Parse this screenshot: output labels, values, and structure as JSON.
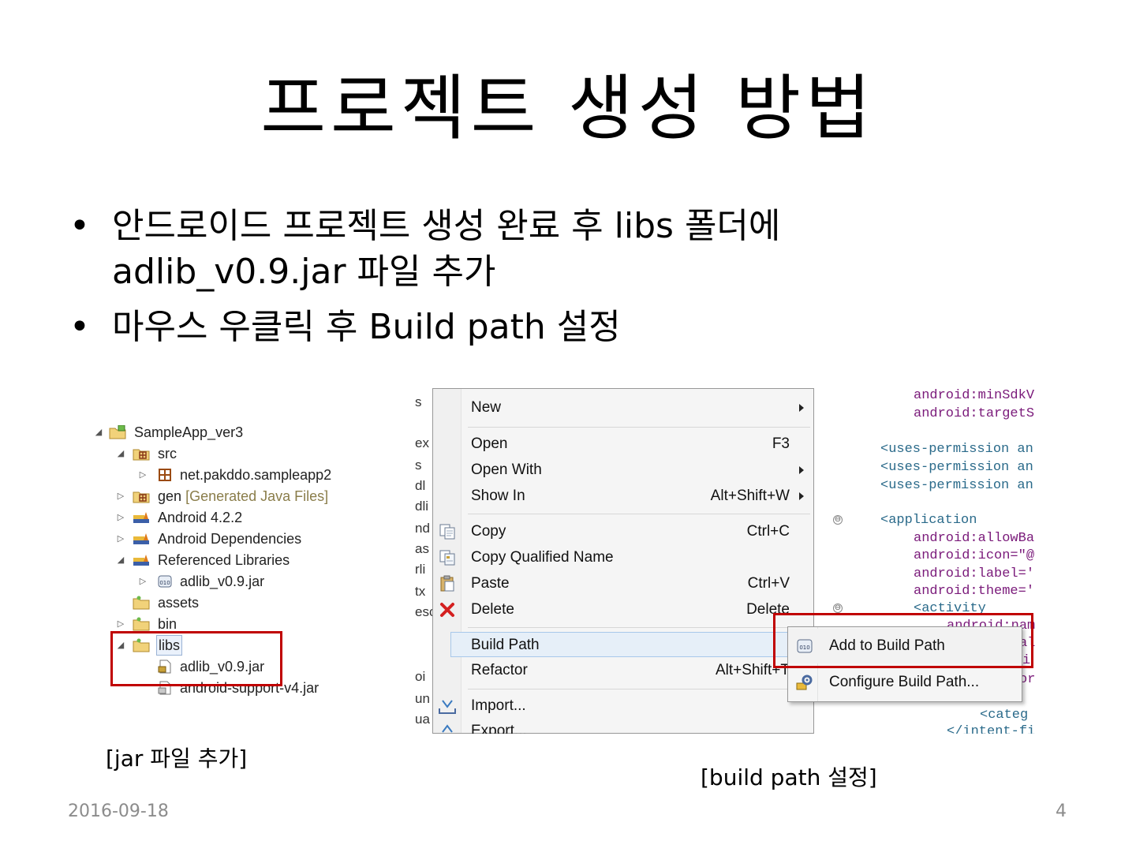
{
  "slide": {
    "title": "프로젝트 생성 방법",
    "bullets": [
      {
        "line1": "안드로이드 프로젝트 생성 완료 후 libs 폴더에",
        "line2": "adlib_v0.9.jar 파일 추가"
      },
      {
        "line1": "마우스 우클릭 후 Build path 설정"
      }
    ],
    "bullet_char": "•",
    "captions": {
      "left": "[jar 파일 추가]",
      "right": "[build path 설정]"
    },
    "footer": {
      "date": "2016-09-18",
      "page": "4"
    }
  },
  "explorer": {
    "items": [
      {
        "label": "SampleApp_ver3",
        "icon": "project-icon",
        "twisty": "◢"
      },
      {
        "label": "src",
        "icon": "source-folder-icon",
        "twisty": "◢"
      },
      {
        "label": "net.pakddo.sampleapp2",
        "icon": "package-icon",
        "twisty": "▷"
      },
      {
        "label": "gen",
        "dim": "[Generated Java Files]",
        "icon": "source-folder-icon",
        "twisty": "▷"
      },
      {
        "label": "Android 4.2.2",
        "icon": "library-icon",
        "twisty": "▷"
      },
      {
        "label": "Android Dependencies",
        "icon": "library-icon",
        "twisty": "▷"
      },
      {
        "label": "Referenced Libraries",
        "icon": "library-icon",
        "twisty": "◢"
      },
      {
        "label": "adlib_v0.9.jar",
        "icon": "jar-icon",
        "twisty": "▷"
      },
      {
        "label": "assets",
        "icon": "folder-icon",
        "twisty": ""
      },
      {
        "label": "bin",
        "icon": "folder-icon",
        "twisty": "▷"
      },
      {
        "label": "libs",
        "icon": "folder-icon",
        "twisty": "◢"
      },
      {
        "label": "adlib_v0.9.jar",
        "icon": "jar-file-icon",
        "twisty": ""
      },
      {
        "label": "android-support-v4.jar",
        "icon": "jar-file-icon",
        "twisty": ""
      }
    ]
  },
  "context_menu": {
    "bg_fragments": [
      "s",
      "ex",
      "s",
      "dl",
      "dli",
      "nd",
      "as",
      "rli",
      "tx",
      "esc",
      "oi",
      "un",
      "ua"
    ],
    "items": [
      {
        "label": "New",
        "shortcut": "",
        "submenu": true,
        "icon": ""
      },
      {
        "label": "Open",
        "shortcut": "F3",
        "submenu": false,
        "icon": ""
      },
      {
        "label": "Open With",
        "shortcut": "",
        "submenu": true,
        "icon": ""
      },
      {
        "label": "Show In",
        "shortcut": "Alt+Shift+W",
        "submenu": true,
        "icon": ""
      },
      {
        "label": "Copy",
        "shortcut": "Ctrl+C",
        "submenu": false,
        "icon": "copy-icon"
      },
      {
        "label": "Copy Qualified Name",
        "shortcut": "",
        "submenu": false,
        "icon": "copy-qualified-icon"
      },
      {
        "label": "Paste",
        "shortcut": "Ctrl+V",
        "submenu": false,
        "icon": "paste-icon"
      },
      {
        "label": "Delete",
        "shortcut": "Delete",
        "submenu": false,
        "icon": "delete-icon"
      },
      {
        "label": "Build Path",
        "shortcut": "",
        "submenu": true,
        "icon": ""
      },
      {
        "label": "Refactor",
        "shortcut": "Alt+Shift+T",
        "submenu": true,
        "icon": ""
      },
      {
        "label": "Import...",
        "shortcut": "",
        "submenu": false,
        "icon": "import-icon"
      },
      {
        "label": "Export...",
        "shortcut": "",
        "submenu": false,
        "icon": "export-icon"
      }
    ],
    "submenu": [
      {
        "label": "Add to Build Path",
        "icon": "jar-icon"
      },
      {
        "label": "Configure Build Path...",
        "icon": "configure-icon"
      }
    ]
  },
  "code_editor": {
    "lines": [
      {
        "text": "android:minSdkV",
        "kind": "attr"
      },
      {
        "text": "android:targetS",
        "kind": "attr"
      },
      {
        "text": "<uses-permission an",
        "kind": "tag"
      },
      {
        "text": "<uses-permission an",
        "kind": "tag"
      },
      {
        "text": "<uses-permission an",
        "kind": "tag"
      },
      {
        "text": "<application",
        "kind": "tag"
      },
      {
        "text": "android:allowBa",
        "kind": "attr"
      },
      {
        "text": "android:icon=\"@",
        "kind": "attr"
      },
      {
        "text": "android:label='",
        "kind": "attr"
      },
      {
        "text": "android:theme='",
        "kind": "attr"
      },
      {
        "text": "<activity",
        "kind": "tag"
      },
      {
        "text": "android:nam",
        "kind": "attr"
      },
      {
        "text": "al",
        "kind": "attr"
      },
      {
        "text": "i",
        "kind": "attr"
      },
      {
        "text": "or",
        "kind": "attr"
      },
      {
        "text": "<categ",
        "kind": "tag"
      },
      {
        "text": "</intent-fi",
        "kind": "tag"
      }
    ],
    "fold_glyph": "⊖"
  },
  "colors": {
    "highlight_border": "#c00000",
    "footer_text": "#8c8c8c"
  }
}
